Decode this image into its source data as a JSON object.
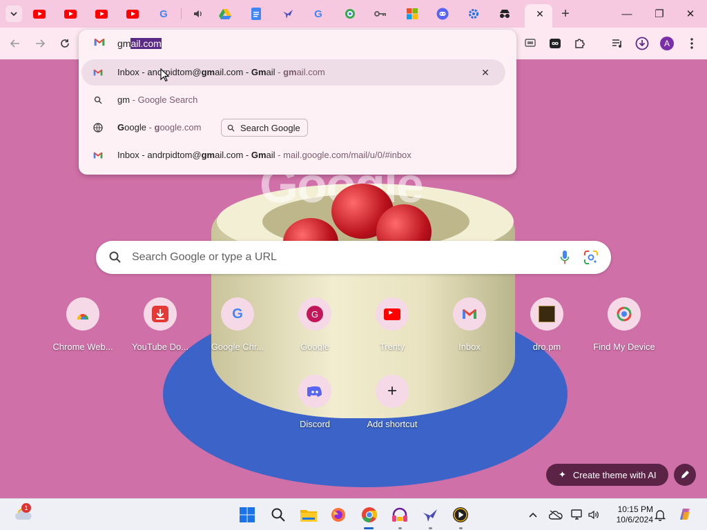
{
  "tabstrip": {
    "tabs": [
      {
        "icon": "youtube-icon"
      },
      {
        "icon": "youtube-icon"
      },
      {
        "icon": "youtube-icon"
      },
      {
        "icon": "youtube-icon"
      },
      {
        "icon": "google-icon"
      },
      {
        "icon": "speaker-icon"
      },
      {
        "icon": "google-drive-icon"
      },
      {
        "icon": "google-docs-icon"
      },
      {
        "icon": "bird-icon"
      },
      {
        "icon": "google-icon"
      },
      {
        "icon": "find-my-device-icon"
      },
      {
        "icon": "key-icon"
      },
      {
        "icon": "microsoft-icon"
      },
      {
        "icon": "discord-icon"
      },
      {
        "icon": "settings-gear-icon"
      },
      {
        "icon": "incognito-icon"
      }
    ],
    "active_tab": {
      "close_label": "✕"
    },
    "new_tab_label": "+",
    "window": {
      "minimize": "—",
      "restore": "❐",
      "close": "✕"
    }
  },
  "omnibox": {
    "typed": "gm",
    "autocomplete": "ail.com",
    "suggestions": [
      {
        "icon": "gmail-icon",
        "parts": [
          "Inbox - andrpidtom@",
          "gm",
          "ail.com - ",
          "Gm",
          "ail"
        ],
        "url_parts": [
          " - ",
          "gm",
          "ail.com"
        ],
        "remove_label": "✕"
      },
      {
        "icon": "search-icon",
        "text": "gm",
        "suffix": " - Google Search"
      },
      {
        "icon": "globe-icon",
        "bold": "G",
        "rest": "oogle",
        "url_prefix": " - ",
        "url_bold": "g",
        "url_rest": "oogle.com",
        "chip_label": "Search Google"
      },
      {
        "icon": "gmail-icon",
        "parts": [
          "Inbox - andrpidtom@",
          "gm",
          "ail.com - ",
          "Gm",
          "ail"
        ],
        "url": " - mail.google.com/mail/u/0/#inbox"
      }
    ]
  },
  "toolbar": {
    "profile_initial": "A"
  },
  "ntp": {
    "doodle_text": "Google",
    "search_placeholder": "Search Google or type a URL",
    "shortcuts": [
      {
        "label": "Chrome Web...",
        "icon": "chrome-web-store-icon"
      },
      {
        "label": "YouTube Do...",
        "icon": "youtube-downloader-icon"
      },
      {
        "label": "Google Chr...",
        "icon": "google-icon"
      },
      {
        "label": "Google",
        "icon": "google-g-avatar-icon",
        "letter": "G"
      },
      {
        "label": "Trenty",
        "icon": "youtube-icon"
      },
      {
        "label": "Inbox",
        "icon": "gmail-icon"
      },
      {
        "label": "dro.pm",
        "icon": "dropm-icon"
      },
      {
        "label": "Find My Device",
        "icon": "find-my-device-icon"
      },
      {
        "label": "Discord",
        "icon": "discord-icon"
      },
      {
        "label": "Add shortcut",
        "icon": "plus-icon",
        "glyph": "+"
      }
    ],
    "create_theme_label": "Create theme with AI"
  },
  "taskbar": {
    "weather_badge": "1",
    "clock_time": "10:15 PM",
    "clock_date": "10/6/2024"
  },
  "colors": {
    "background": "#d070a8",
    "tabstrip": "#f6c9e0",
    "toolbar": "#fde8f1",
    "selection": "#5b2a86",
    "create_theme_button": "#5b2346"
  }
}
